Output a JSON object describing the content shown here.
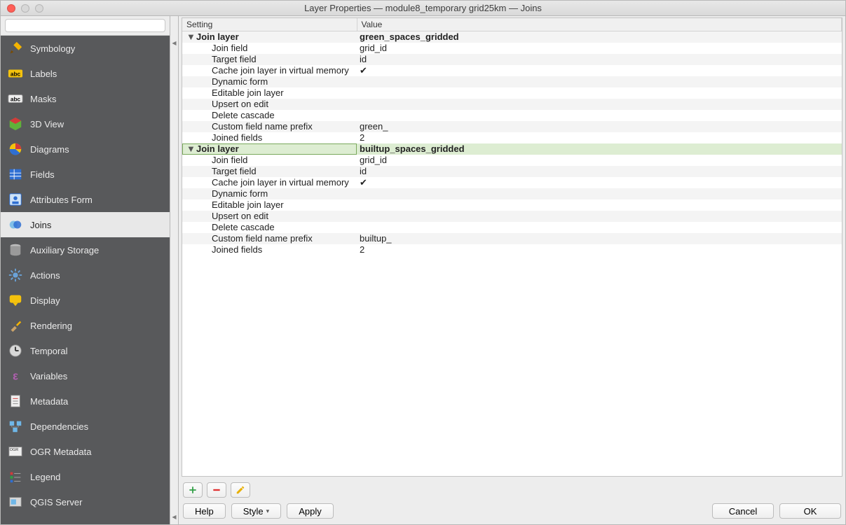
{
  "window": {
    "title": "Layer Properties — module8_temporary grid25km — Joins"
  },
  "search": {
    "placeholder": ""
  },
  "sidebar": {
    "items": [
      {
        "label": "Symbology",
        "icon": "paintbrush"
      },
      {
        "label": "Labels",
        "icon": "abc-yellow"
      },
      {
        "label": "Masks",
        "icon": "abc-white"
      },
      {
        "label": "3D View",
        "icon": "cube"
      },
      {
        "label": "Diagrams",
        "icon": "piechart"
      },
      {
        "label": "Fields",
        "icon": "table"
      },
      {
        "label": "Attributes Form",
        "icon": "form"
      },
      {
        "label": "Joins",
        "icon": "join",
        "selected": true
      },
      {
        "label": "Auxiliary Storage",
        "icon": "db"
      },
      {
        "label": "Actions",
        "icon": "gear"
      },
      {
        "label": "Display",
        "icon": "tooltip"
      },
      {
        "label": "Rendering",
        "icon": "brush2"
      },
      {
        "label": "Temporal",
        "icon": "clock"
      },
      {
        "label": "Variables",
        "icon": "epsilon"
      },
      {
        "label": "Metadata",
        "icon": "doc"
      },
      {
        "label": "Dependencies",
        "icon": "deps"
      },
      {
        "label": "OGR Metadata",
        "icon": "ogr"
      },
      {
        "label": "Legend",
        "icon": "legend"
      },
      {
        "label": "QGIS Server",
        "icon": "server"
      }
    ]
  },
  "columns": {
    "setting": "Setting",
    "value": "Value"
  },
  "joins": [
    {
      "setting": "Join layer",
      "value": "green_spaces_gridded",
      "selected": false,
      "rows": [
        {
          "setting": "Join field",
          "value": "grid_id"
        },
        {
          "setting": "Target field",
          "value": "id"
        },
        {
          "setting": "Cache join layer in virtual memory",
          "value": "✔"
        },
        {
          "setting": "Dynamic form",
          "value": ""
        },
        {
          "setting": "Editable join layer",
          "value": ""
        },
        {
          "setting": "Upsert on edit",
          "value": ""
        },
        {
          "setting": "Delete cascade",
          "value": ""
        },
        {
          "setting": "Custom field name prefix",
          "value": "green_"
        },
        {
          "setting": "Joined fields",
          "value": "2"
        }
      ]
    },
    {
      "setting": "Join layer",
      "value": "builtup_spaces_gridded",
      "selected": true,
      "rows": [
        {
          "setting": "Join field",
          "value": "grid_id"
        },
        {
          "setting": "Target field",
          "value": "id"
        },
        {
          "setting": "Cache join layer in virtual memory",
          "value": "✔"
        },
        {
          "setting": "Dynamic form",
          "value": ""
        },
        {
          "setting": "Editable join layer",
          "value": ""
        },
        {
          "setting": "Upsert on edit",
          "value": ""
        },
        {
          "setting": "Delete cascade",
          "value": ""
        },
        {
          "setting": "Custom field name prefix",
          "value": "builtup_"
        },
        {
          "setting": "Joined fields",
          "value": "2"
        }
      ]
    }
  ],
  "toolbar": {
    "add": {
      "icon": "plus",
      "color": "#2f9e44"
    },
    "remove": {
      "icon": "minus",
      "color": "#e03131"
    },
    "edit": {
      "icon": "pencil",
      "color": "#e8b007"
    }
  },
  "footer": {
    "help": "Help",
    "style": "Style",
    "apply": "Apply",
    "cancel": "Cancel",
    "ok": "OK"
  }
}
